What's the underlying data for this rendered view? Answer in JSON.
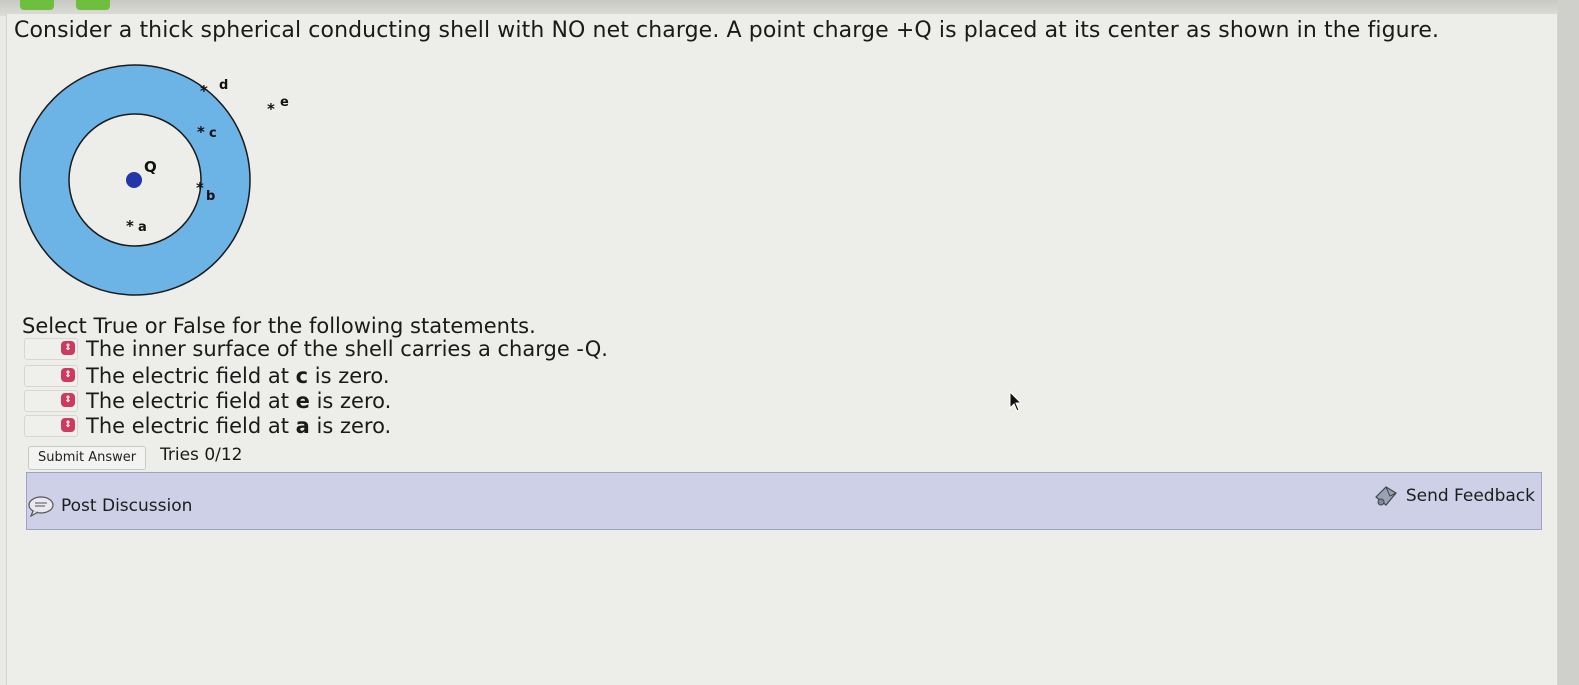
{
  "question": {
    "text": "Consider a thick spherical conducting shell with NO net charge. A point charge +Q is placed at its center as shown in the figure."
  },
  "figure": {
    "labels": {
      "charge": "Q",
      "a": "a",
      "b": "b",
      "c": "c",
      "d": "d",
      "e": "e"
    },
    "colors": {
      "shell": "#6cb3e6",
      "shell_outline": "#1b1b1b",
      "charge": "#2136a8"
    }
  },
  "instructions": "Select True or False for the following statements.",
  "statements": [
    {
      "pre": "The inner surface of the shell carries a charge -Q.",
      "bold": "",
      "post": ""
    },
    {
      "pre": "The electric field at ",
      "bold": "c",
      "post": " is zero."
    },
    {
      "pre": "The electric field at ",
      "bold": "e",
      "post": " is zero."
    },
    {
      "pre": "The electric field at ",
      "bold": "a",
      "post": " is zero."
    }
  ],
  "submit": {
    "label": "Submit Answer"
  },
  "tries": "Tries 0/12",
  "footer": {
    "post_discussion": "Post Discussion",
    "send_feedback": "Send Feedback"
  },
  "icons": {
    "select_spinner": "select-spinner-icon",
    "discussion": "speech-bubble-icon",
    "feedback": "feedback-icon",
    "cursor": "mouse-cursor-icon"
  }
}
